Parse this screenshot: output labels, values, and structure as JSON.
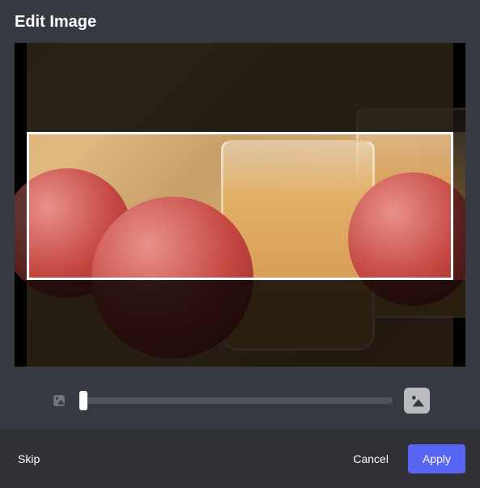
{
  "header": {
    "title": "Edit Image"
  },
  "zoom": {
    "small_icon": "image-small-icon",
    "large_icon": "image-large-icon",
    "value": 0,
    "min": 0,
    "max": 100
  },
  "footer": {
    "skip_label": "Skip",
    "cancel_label": "Cancel",
    "apply_label": "Apply"
  }
}
